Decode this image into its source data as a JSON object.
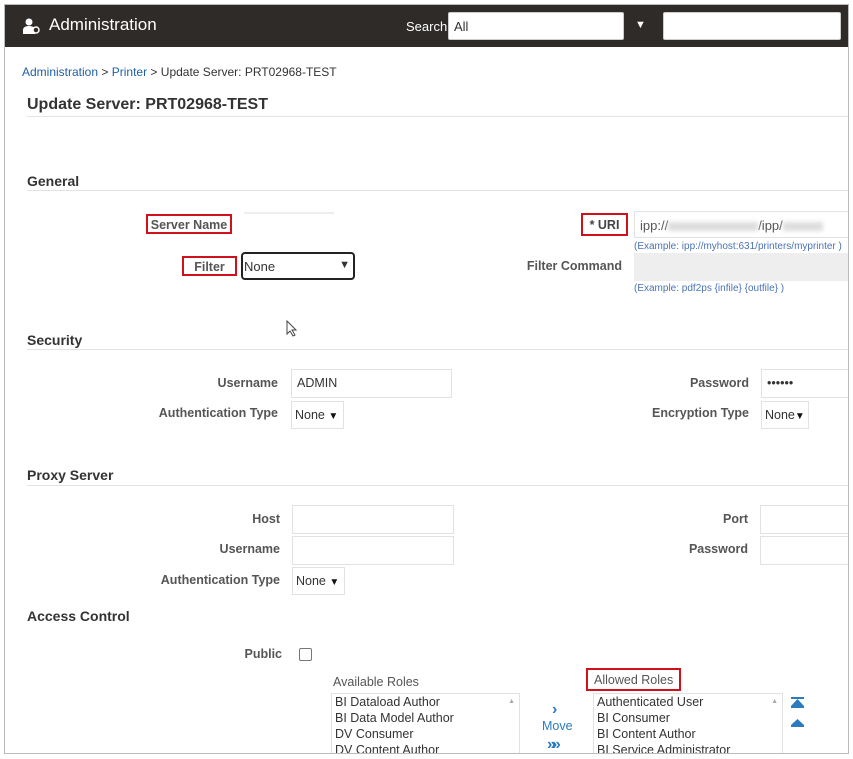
{
  "header": {
    "title": "Administration",
    "search_label": "Search",
    "search_scope": "All",
    "search_value": ""
  },
  "breadcrumb": {
    "items": [
      "Administration",
      "Printer"
    ],
    "separator": ">",
    "current": "Update Server: PRT02968-TEST"
  },
  "page_title": "Update Server: PRT02968-TEST",
  "general": {
    "heading": "General",
    "server_name_label": "Server Name",
    "server_name_value": "",
    "filter_label": "Filter",
    "filter_value": "None",
    "uri_label": "* URI",
    "uri_prefix": "ipp://",
    "uri_mid": "/ipp/",
    "uri_example": "(Example: ipp://myhost:631/printers/myprinter )",
    "filter_command_label": "Filter Command",
    "filter_command_example": "(Example: pdf2ps {infile} {outfile} )"
  },
  "security": {
    "heading": "Security",
    "username_label": "Username",
    "username_value": "ADMIN",
    "password_label": "Password",
    "password_value": "••••••",
    "auth_type_label": "Authentication Type",
    "auth_type_value": "None",
    "encryption_type_label": "Encryption Type",
    "encryption_type_value": "None"
  },
  "proxy": {
    "heading": "Proxy Server",
    "host_label": "Host",
    "port_label": "Port",
    "username_label": "Username",
    "password_label": "Password",
    "auth_type_label": "Authentication Type",
    "auth_type_value": "None"
  },
  "access": {
    "heading": "Access Control",
    "public_label": "Public",
    "available_label": "Available Roles",
    "available_roles": [
      "BI Dataload Author",
      "BI Data Model Author",
      "DV Consumer",
      "DV Content Author"
    ],
    "move_label": "Move",
    "allowed_label": "Allowed Roles",
    "allowed_roles": [
      "Authenticated User",
      "BI Consumer",
      "BI Content Author",
      "BI Service Administrator"
    ]
  }
}
